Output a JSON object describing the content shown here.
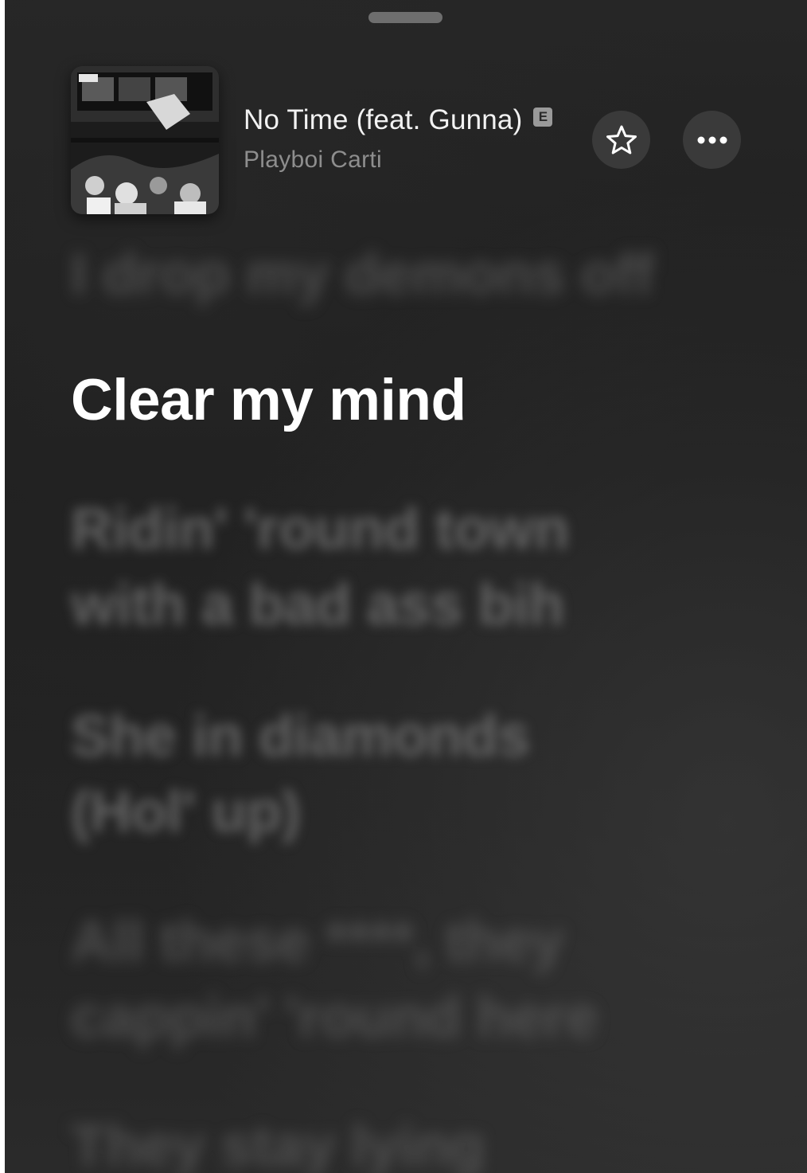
{
  "sheet": {
    "grabber": "drag-handle"
  },
  "now_playing": {
    "title": "No Time (feat. Gunna)",
    "explicit_badge": "E",
    "artist": "Playboi Carti",
    "artwork_icon": "album-artwork",
    "favorite_icon": "star-outline-icon",
    "more_icon": "ellipsis-icon"
  },
  "lyrics": {
    "previous": "I drop my demons off",
    "current": "Clear my mind",
    "upcoming": [
      [
        "Ridin' 'round town",
        "with a bad ass bih"
      ],
      [
        "She in diamonds",
        "(Hol' up)"
      ],
      [
        "All these ****, they",
        "cappin' 'round here"
      ],
      [
        "They stay lying"
      ]
    ]
  },
  "colors": {
    "background": "#222222",
    "active_lyric": "#ffffff",
    "inactive_lyric": "#787878",
    "button_bg": "#3a3a3a",
    "artist_text": "#8e8e8e"
  }
}
